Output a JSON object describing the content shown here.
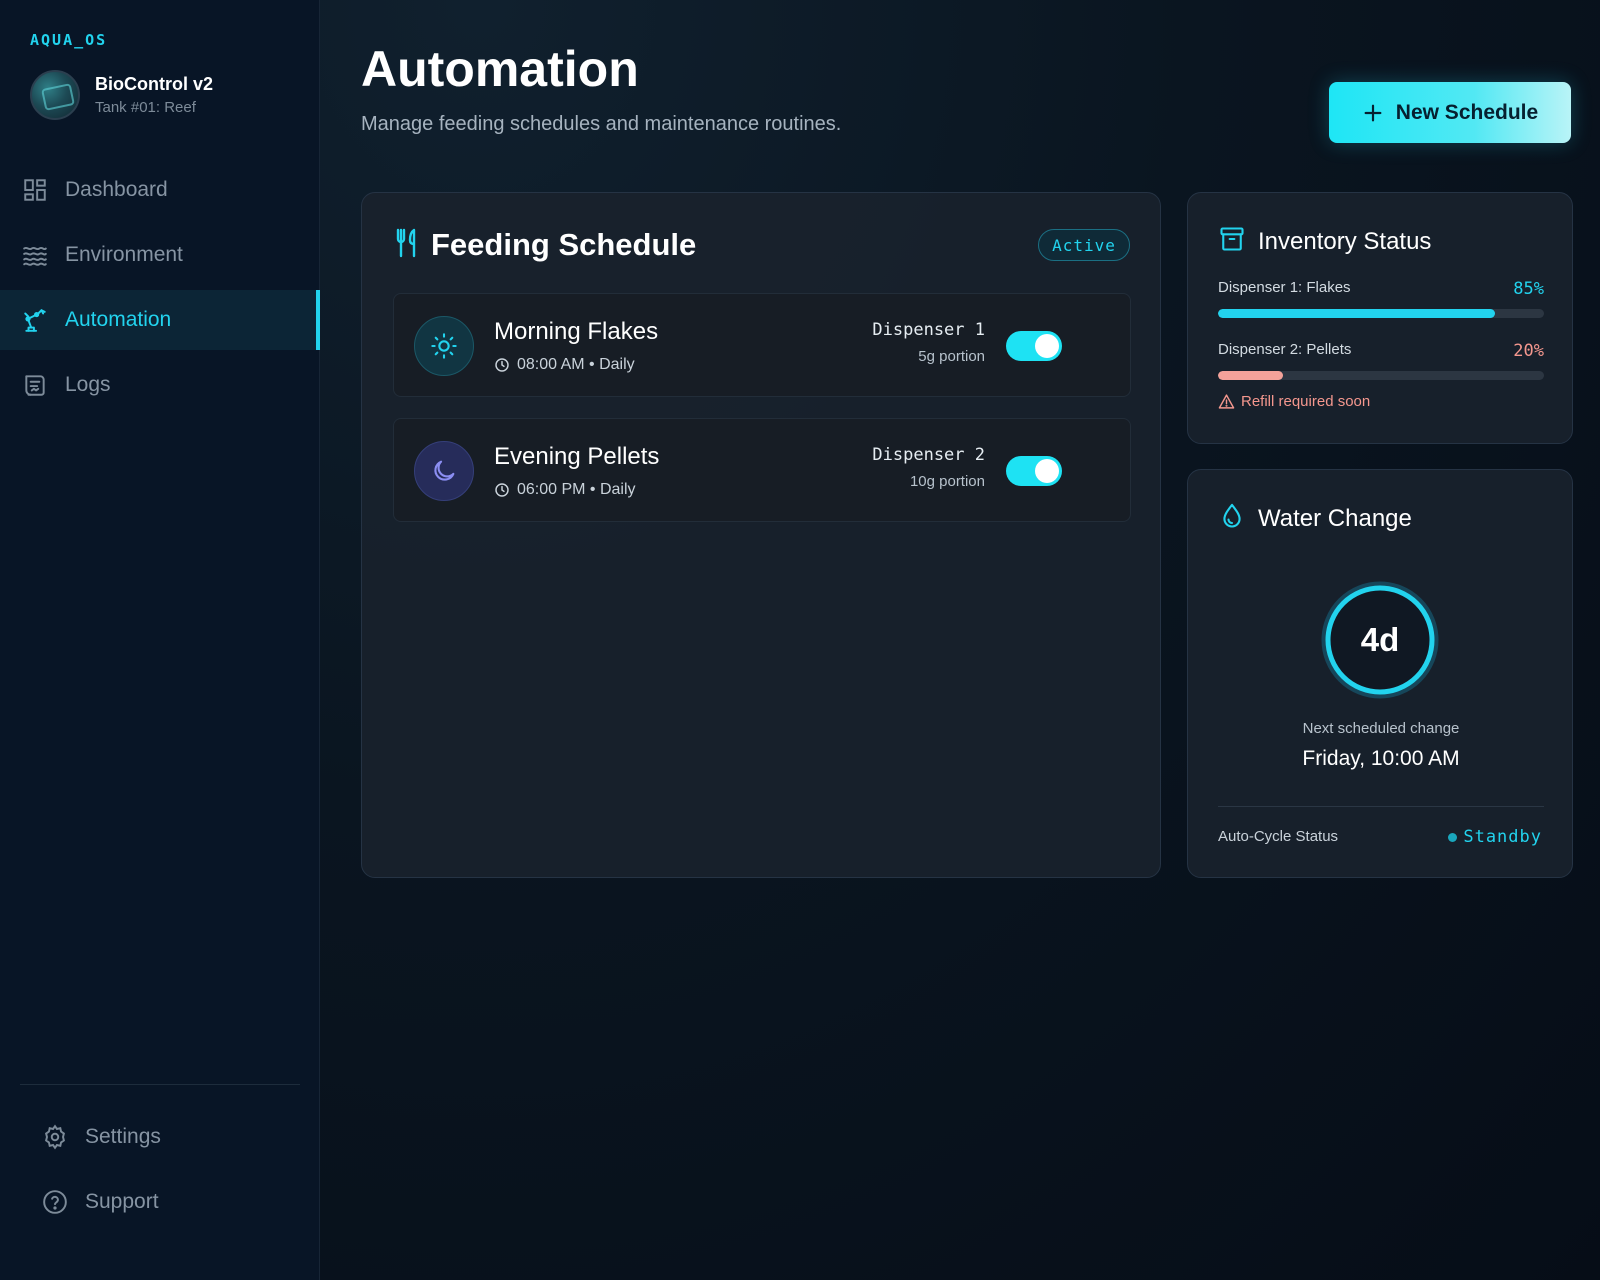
{
  "brand": "AQUA_OS",
  "profile": {
    "name": "BioControl v2",
    "subtitle": "Tank #01: Reef"
  },
  "nav": {
    "items": [
      {
        "label": "Dashboard",
        "icon": "dashboard-icon"
      },
      {
        "label": "Environment",
        "icon": "waves-icon"
      },
      {
        "label": "Automation",
        "icon": "robot-arm-icon",
        "active": true
      },
      {
        "label": "Logs",
        "icon": "logs-icon"
      }
    ],
    "bottom": [
      {
        "label": "Settings",
        "icon": "gear-icon"
      },
      {
        "label": "Support",
        "icon": "help-icon"
      }
    ]
  },
  "header": {
    "title": "Automation",
    "subtitle": "Manage feeding schedules and maintenance routines.",
    "new_button": "New Schedule"
  },
  "feeding": {
    "title": "Feeding Schedule",
    "badge": "Active",
    "schedules": [
      {
        "name": "Morning Flakes",
        "time": "08:00 AM • Daily",
        "dispenser": "Dispenser 1",
        "portion": "5g portion",
        "icon": "sun-icon",
        "enabled": true
      },
      {
        "name": "Evening Pellets",
        "time": "06:00 PM • Daily",
        "dispenser": "Dispenser 2",
        "portion": "10g portion",
        "icon": "moon-icon",
        "enabled": true
      }
    ]
  },
  "inventory": {
    "title": "Inventory Status",
    "items": [
      {
        "label": "Dispenser 1: Flakes",
        "percent_text": "85%",
        "level": 0.85,
        "color": "#22d3ee"
      },
      {
        "label": "Dispenser 2: Pellets",
        "percent_text": "20%",
        "level": 0.2,
        "color": "#f4a29a"
      }
    ],
    "warning": "Refill required soon"
  },
  "water": {
    "title": "Water Change",
    "countdown": "4d",
    "next_label": "Next scheduled change",
    "next_value": "Friday, 10:00 AM",
    "auto_label": "Auto-Cycle Status",
    "auto_status": "Standby"
  },
  "colors": {
    "accent": "#22d3ee",
    "warning": "#f4978e",
    "background": "#081526"
  }
}
